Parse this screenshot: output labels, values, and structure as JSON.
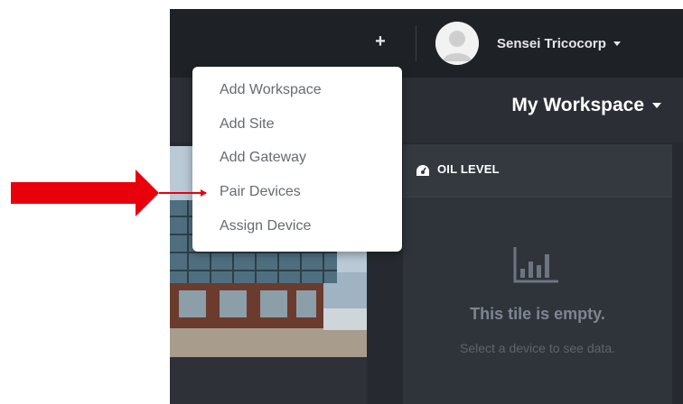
{
  "colors": {
    "topbar": "#1e2227",
    "background": "#262a30",
    "tile": "#2f343b",
    "annotation_arrow": "#e8000b"
  },
  "header": {
    "add_icon": "plus-icon",
    "add_label": "+",
    "user": {
      "avatar_icon": "user-avatar-icon",
      "name": "Sensei Tricocorp"
    }
  },
  "workspace": {
    "title": "My Workspace"
  },
  "add_menu": {
    "items": [
      {
        "label": "Add Workspace"
      },
      {
        "label": "Add Site"
      },
      {
        "label": "Add Gateway"
      },
      {
        "label": "Pair Devices"
      },
      {
        "label": "Assign Device"
      }
    ]
  },
  "tiles": {
    "oil_level": {
      "icon": "gauge-icon",
      "title": "OIL LEVEL",
      "empty_icon": "bar-chart-icon",
      "empty_title": "This tile is empty.",
      "empty_message": "Select a device to see data."
    }
  }
}
